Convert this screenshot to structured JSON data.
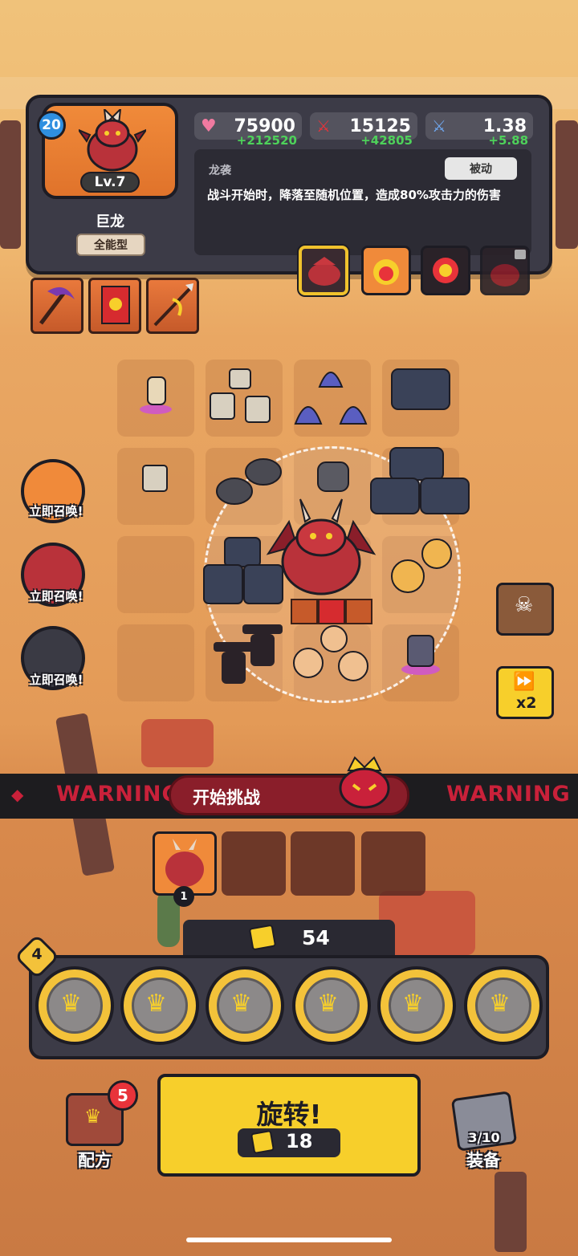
{
  "unit": {
    "level_badge": "20",
    "level": "Lv.7",
    "name": "巨龙",
    "type": "全能型"
  },
  "stats": {
    "hp": "75900",
    "hp_plus": "+212520",
    "attack": "15125",
    "attack_plus": "+42805",
    "speed": "1.38",
    "speed_plus": "+5.88"
  },
  "skill": {
    "name": "龙袭",
    "tag": "被动",
    "description": "战斗开始时，降落至随机位置，造成80%攻击力的伤害"
  },
  "summon_label": "立即召唤!",
  "warning_text": "WARNING",
  "start_button": "开始挑战",
  "queue_count": "1",
  "coins": "54",
  "slot_count": "4",
  "spin": {
    "label": "旋转!",
    "cost": "18"
  },
  "recipe": {
    "label": "配方",
    "badge": "5"
  },
  "equipment": {
    "label": "装备",
    "count": "3/10"
  },
  "speed_toggle": "x2",
  "colors": {
    "panel": "#3c3b47",
    "accent_yellow": "#f7cf2b",
    "warning_red": "#c9213a",
    "plus_green": "#4ed15a"
  }
}
